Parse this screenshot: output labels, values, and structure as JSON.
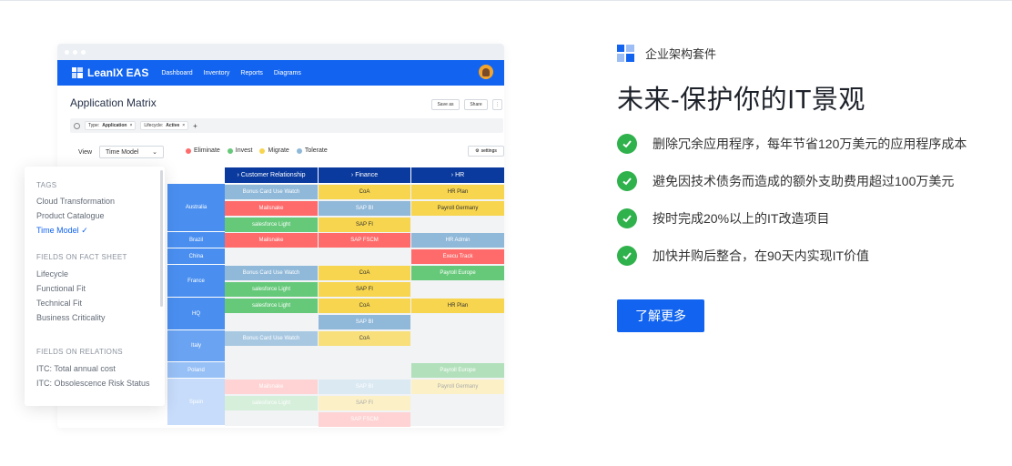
{
  "app": {
    "brand": "LeanIX EAS",
    "nav": [
      "Dashboard",
      "Inventory",
      "Reports",
      "Diagrams"
    ],
    "title": "Application Matrix",
    "save_as": "Save as",
    "share": "Share",
    "more": "⋮",
    "filters": {
      "type_label": "Type:",
      "type_value": "Application",
      "lifecycle_label": "Lifecycle:",
      "lifecycle_value": "Active",
      "close": "×",
      "add": "+"
    },
    "view_label": "View",
    "view_value": "Time Model",
    "legend": [
      {
        "label": "Eliminate",
        "color": "#ff6b6b"
      },
      {
        "label": "Invest",
        "color": "#66c97a"
      },
      {
        "label": "Migrate",
        "color": "#f7d54e"
      },
      {
        "label": "Tolerate",
        "color": "#8fb8d9"
      }
    ],
    "settings": "settings",
    "columns": [
      "Customer Relationship",
      "Finance",
      "HR"
    ],
    "rows": [
      "Australia",
      "Brazil",
      "China",
      "France",
      "HQ",
      "Italy",
      "Poland",
      "Spain"
    ],
    "cells": {
      "au_cr_1": "Bonus Card Use Watch",
      "au_cr_2": "Mailsnake",
      "au_cr_3": "salesforce Light",
      "au_fi_1": "CoA",
      "au_fi_2": "SAP BI",
      "au_fi_3": "SAP FI",
      "au_hr_1": "HR Plan",
      "au_hr_2": "Payroll Germany",
      "br_cr_1": "Mailsnake",
      "br_fi_1": "SAP FSCM",
      "br_hr_1": "HR Admin",
      "cn_hr_1": "Execu Track",
      "fr_cr_1": "Bonus Card Use Watch",
      "fr_cr_2": "salesforce Light",
      "fr_fi_1": "CoA",
      "fr_fi_2": "SAP FI",
      "fr_hr_1": "Payroll Europe",
      "hq_cr_1": "salesforce Light",
      "hq_fi_1": "CoA",
      "hq_fi_2": "SAP BI",
      "hq_hr_1": "HR Plan",
      "it_cr_1": "Bonus Card Use Watch",
      "it_fi_1": "CoA",
      "pl_hr_1": "Payroll Europe",
      "es_cr_1": "Mailsnake",
      "es_cr_2": "salesforce Light",
      "es_fi_1": "SAP BI",
      "es_fi_2": "SAP FI",
      "es_fi_3": "SAP FSCM",
      "es_hr_1": "Payroll Germany"
    },
    "panel": {
      "tags_head": "TAGS",
      "tags": [
        "Cloud Transformation",
        "Product Catalogue",
        "Time Model"
      ],
      "fact_head": "FIELDS ON FACT SHEET",
      "fact": [
        "Lifecycle",
        "Functional Fit",
        "Technical Fit",
        "Business Criticality"
      ],
      "rel_head": "FIELDS ON RELATIONS",
      "rel": [
        "ITC: Total annual cost",
        "ITC: Obsolescence Risk Status"
      ]
    }
  },
  "marketing": {
    "brand": "企业架构套件",
    "headline": "未来-保护你的IT景观",
    "features": [
      "删除冗余应用程序，每年节省120万美元的应用程序成本",
      "避免因技术债务而造成的额外支助费用超过100万美元",
      "按时完成20%以上的IT改造项目",
      "加快并购后整合，在90天内实现IT价值"
    ],
    "cta": "了解更多"
  },
  "colors": {
    "accent": "#1264f0",
    "header": "#0a3a9e",
    "check": "#2fb14b"
  }
}
